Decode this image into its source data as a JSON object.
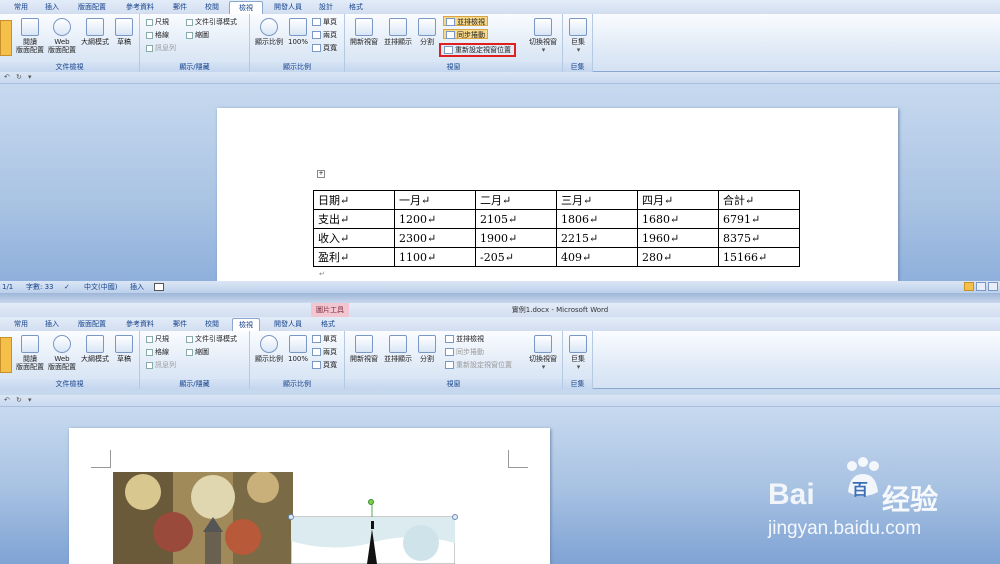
{
  "top": {
    "tabs": [
      "常用",
      "插入",
      "版面配置",
      "參考資料",
      "郵件",
      "校閱",
      "檢視",
      "開發人員",
      "設計",
      "格式"
    ],
    "groups": {
      "doc_views": {
        "label": "文件檢視",
        "buttons": [
          "閱讀\n版面配置",
          "Web\n版面配置",
          "大綱模式",
          "草稿"
        ]
      },
      "show_hide": {
        "label": "顯示/隱藏",
        "items": [
          "尺規",
          "格線",
          "訊息列",
          "文件引導模式",
          "縮圖"
        ]
      },
      "zoom": {
        "label": "顯示比例",
        "buttons": [
          "顯示比例",
          "100%"
        ],
        "small": [
          "單頁",
          "兩頁",
          "頁寬"
        ]
      },
      "window": {
        "label": "視窗",
        "buttons": [
          "開新視窗",
          "並排顯示",
          "分割"
        ],
        "small": [
          "並排檢視",
          "同步捲動",
          "重新設定視窗位置"
        ],
        "switch": "切換視窗"
      },
      "macro": {
        "label": "巨集",
        "button": "巨集"
      }
    }
  },
  "table": {
    "rows": [
      [
        "日期",
        "一月",
        "二月",
        "三月",
        "四月",
        "合計"
      ],
      [
        "支出",
        "1200",
        "2105",
        "1806",
        "1680",
        "6791"
      ],
      [
        "收入",
        "2300",
        "1900",
        "2215",
        "1960",
        "8375"
      ],
      [
        "盈利",
        "1100",
        "-205",
        "409",
        "280",
        "15166"
      ]
    ],
    "mark": "↵"
  },
  "status": {
    "page": "1/1",
    "words": "字數: 33",
    "lang": "中文(中國)",
    "mode": "插入"
  },
  "bottom": {
    "title": "實例1.docx - Microsoft Word",
    "context_tab": "圖片工具",
    "tabs": [
      "常用",
      "插入",
      "版面配置",
      "參考資料",
      "郵件",
      "校閱",
      "檢視",
      "開發人員",
      "格式"
    ]
  },
  "watermark": {
    "brand": "Bai",
    "brand2": "百",
    "site": "jingyan.baidu.com",
    "cn": "经验"
  }
}
